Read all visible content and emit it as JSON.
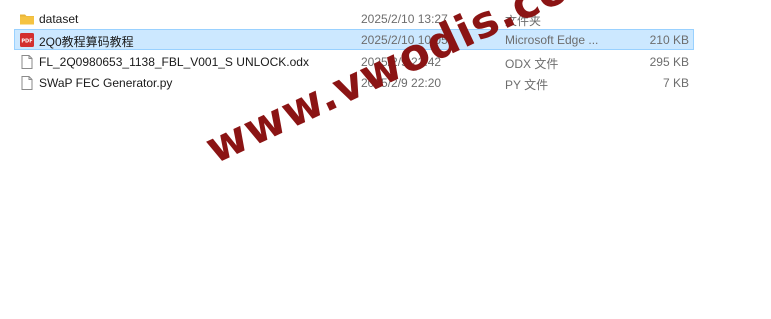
{
  "files": [
    {
      "name": "dataset",
      "date": "2025/2/10 13:27",
      "type": "文件夹",
      "size": "",
      "icon": "folder-icon"
    },
    {
      "name": "2Q0教程算码教程",
      "date": "2025/2/10 10:05",
      "type": "Microsoft Edge ...",
      "size": "210 KB",
      "icon": "pdf-icon",
      "selected": true
    },
    {
      "name": "FL_2Q0980653_1138_FBL_V001_S UNLOCK.odx",
      "date": "2025/2/9 22:42",
      "type": "ODX 文件",
      "size": "295 KB",
      "icon": "document-icon"
    },
    {
      "name": "SWaP FEC Generator.py",
      "date": "2025/2/9 22:20",
      "type": "PY 文件",
      "size": "7 KB",
      "icon": "document-icon"
    }
  ],
  "watermark": {
    "text": "www.vwodis.com",
    "color": "#8b1414"
  },
  "colors": {
    "selection_bg": "#cce8ff",
    "selection_border": "#99d1ff",
    "folder": "#f5c342",
    "pdf": "#d32f2f",
    "meta_text": "#6d6d6d"
  }
}
